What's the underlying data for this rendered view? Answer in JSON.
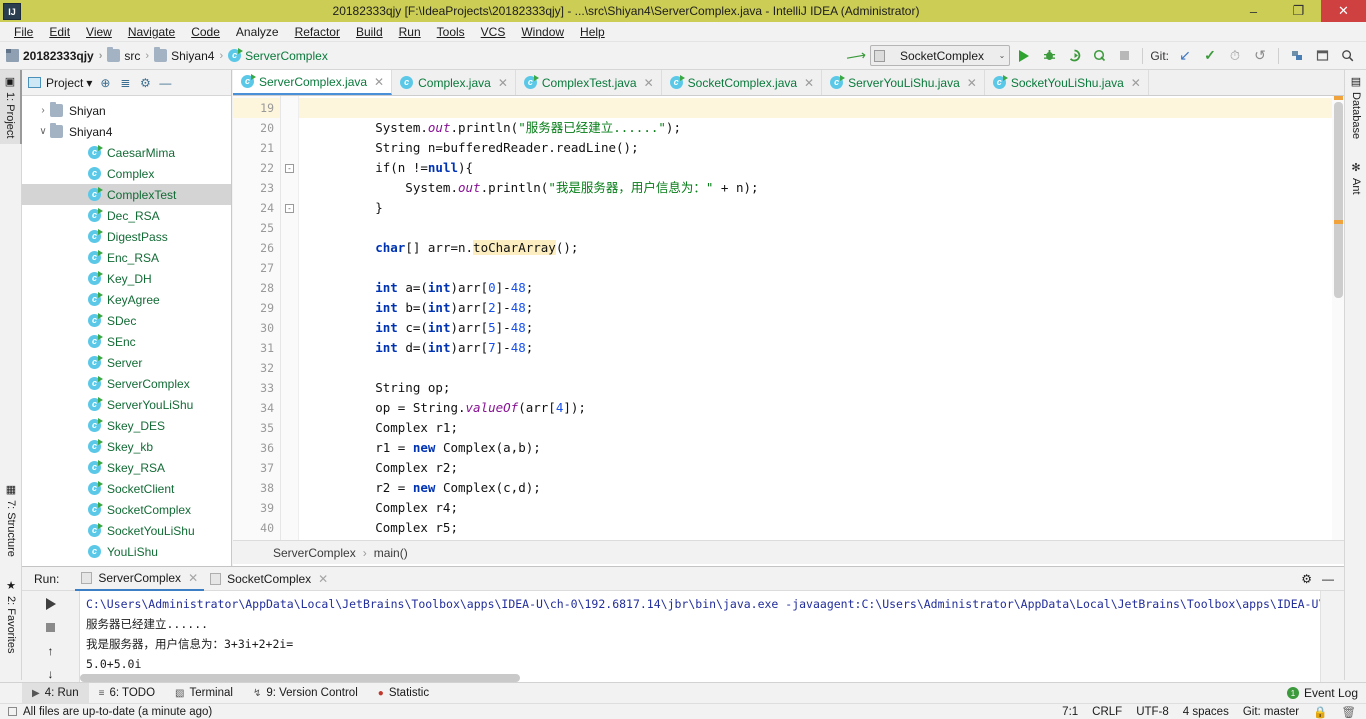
{
  "window": {
    "title": "20182333qjy [F:\\IdeaProjects\\20182333qjy] - ...\\src\\Shiyan4\\ServerComplex.java - IntelliJ IDEA (Administrator)",
    "logo": "IJ",
    "minimize": "–",
    "maximize": "❐",
    "close": "✕",
    "titlebar_color": "#cccd55"
  },
  "menubar": [
    {
      "label": "File"
    },
    {
      "label": "Edit"
    },
    {
      "label": "View"
    },
    {
      "label": "Navigate"
    },
    {
      "label": "Code"
    },
    {
      "label": "Analyze"
    },
    {
      "label": "Refactor"
    },
    {
      "label": "Build"
    },
    {
      "label": "Run"
    },
    {
      "label": "Tools"
    },
    {
      "label": "VCS"
    },
    {
      "label": "Window"
    },
    {
      "label": "Help"
    }
  ],
  "navbar": {
    "breadcrumbs": [
      {
        "label": "20182333qjy",
        "icon": "module-icon"
      },
      {
        "label": "src",
        "icon": "folder-icon"
      },
      {
        "label": "Shiyan4",
        "icon": "folder-icon"
      },
      {
        "label": "ServerComplex",
        "icon": "java-class-icon"
      }
    ],
    "run_config": "SocketComplex",
    "run_config_arrow": "⌄",
    "git_label": "Git:",
    "icons": [
      "back-arrow-icon",
      "run-icon",
      "debug-icon",
      "run-coverage-icon",
      "profile-icon",
      "stop-icon",
      "update-project-icon",
      "commit-icon",
      "history-icon",
      "rollback-icon",
      "settings-sync-icon",
      "layout-icon",
      "search-everywhere-icon"
    ]
  },
  "left_strip": [
    {
      "label": "1: Project",
      "selected": true,
      "icon": "project-icon"
    },
    {
      "label": "7: Structure",
      "selected": false,
      "icon": "structure-icon"
    },
    {
      "label": "2: Favorites",
      "selected": false,
      "icon": "star-icon"
    }
  ],
  "right_strip": [
    {
      "label": "Database",
      "icon": "database-icon"
    },
    {
      "label": "Ant",
      "icon": "ant-icon"
    }
  ],
  "project_panel": {
    "title": "Project",
    "title_arrow": "▾",
    "header_icons": [
      "locate-icon",
      "collapse-all-icon",
      "settings-icon",
      "hide-icon"
    ],
    "tree": [
      {
        "label": "Shiyan",
        "type": "folder",
        "indent": 1,
        "twisty": "›",
        "selected": false
      },
      {
        "label": "Shiyan4",
        "type": "folder",
        "indent": 1,
        "twisty": "∨",
        "selected": false
      },
      {
        "label": "CaesarMima",
        "type": "class-run",
        "indent": 2,
        "twisty": "",
        "selected": false
      },
      {
        "label": "Complex",
        "type": "class",
        "indent": 2,
        "twisty": "",
        "selected": false
      },
      {
        "label": "ComplexTest",
        "type": "class-run",
        "indent": 2,
        "twisty": "",
        "selected": true
      },
      {
        "label": "Dec_RSA",
        "type": "class-run",
        "indent": 2,
        "twisty": "",
        "selected": false
      },
      {
        "label": "DigestPass",
        "type": "class-run",
        "indent": 2,
        "twisty": "",
        "selected": false
      },
      {
        "label": "Enc_RSA",
        "type": "class-run",
        "indent": 2,
        "twisty": "",
        "selected": false
      },
      {
        "label": "Key_DH",
        "type": "class-run",
        "indent": 2,
        "twisty": "",
        "selected": false
      },
      {
        "label": "KeyAgree",
        "type": "class-run",
        "indent": 2,
        "twisty": "",
        "selected": false
      },
      {
        "label": "SDec",
        "type": "class-run",
        "indent": 2,
        "twisty": "",
        "selected": false
      },
      {
        "label": "SEnc",
        "type": "class-run",
        "indent": 2,
        "twisty": "",
        "selected": false
      },
      {
        "label": "Server",
        "type": "class-run",
        "indent": 2,
        "twisty": "",
        "selected": false
      },
      {
        "label": "ServerComplex",
        "type": "class-run",
        "indent": 2,
        "twisty": "",
        "selected": false
      },
      {
        "label": "ServerYouLiShu",
        "type": "class-run",
        "indent": 2,
        "twisty": "",
        "selected": false
      },
      {
        "label": "Skey_DES",
        "type": "class-run",
        "indent": 2,
        "twisty": "",
        "selected": false
      },
      {
        "label": "Skey_kb",
        "type": "class-run",
        "indent": 2,
        "twisty": "",
        "selected": false
      },
      {
        "label": "Skey_RSA",
        "type": "class-run",
        "indent": 2,
        "twisty": "",
        "selected": false
      },
      {
        "label": "SocketClient",
        "type": "class-run",
        "indent": 2,
        "twisty": "",
        "selected": false
      },
      {
        "label": "SocketComplex",
        "type": "class-run",
        "indent": 2,
        "twisty": "",
        "selected": false
      },
      {
        "label": "SocketYouLiShu",
        "type": "class-run",
        "indent": 2,
        "twisty": "",
        "selected": false
      },
      {
        "label": "YouLiShu",
        "type": "class",
        "indent": 2,
        "twisty": "",
        "selected": false
      }
    ]
  },
  "editor": {
    "tabs": [
      {
        "label": "ServerComplex.java",
        "active": true,
        "icon": "java-class-run-icon"
      },
      {
        "label": "Complex.java",
        "active": false,
        "icon": "java-class-icon"
      },
      {
        "label": "ComplexTest.java",
        "active": false,
        "icon": "java-class-run-icon"
      },
      {
        "label": "SocketComplex.java",
        "active": false,
        "icon": "java-class-run-icon"
      },
      {
        "label": "ServerYouLiShu.java",
        "active": false,
        "icon": "java-class-run-icon"
      },
      {
        "label": "SocketYouLiShu.java",
        "active": false,
        "icon": "java-class-run-icon"
      }
    ],
    "close_glyph": "✕",
    "first_line_number": 19,
    "highlight_line": 19,
    "lines": [
      {
        "n": 19,
        "fold": "",
        "segs": []
      },
      {
        "n": 20,
        "fold": "",
        "segs": [
          {
            "t": "        System.",
            "c": "mth"
          },
          {
            "t": "out",
            "c": "fld"
          },
          {
            "t": ".println(",
            "c": "mth"
          },
          {
            "t": "\"服务器已经建立......\"",
            "c": "str"
          },
          {
            "t": ");",
            "c": "mth"
          }
        ]
      },
      {
        "n": 21,
        "fold": "",
        "segs": [
          {
            "t": "        String n=bufferedReader.readLine();",
            "c": "mth"
          }
        ]
      },
      {
        "n": 22,
        "fold": "minus",
        "segs": [
          {
            "t": "        if(n !=",
            "c": "mth"
          },
          {
            "t": "null",
            "c": "kw"
          },
          {
            "t": "){",
            "c": "mth"
          }
        ]
      },
      {
        "n": 23,
        "fold": "",
        "segs": [
          {
            "t": "            System.",
            "c": "mth"
          },
          {
            "t": "out",
            "c": "fld"
          },
          {
            "t": ".println(",
            "c": "mth"
          },
          {
            "t": "\"我是服务器，用户信息为：\"",
            "c": "str"
          },
          {
            "t": " + n);",
            "c": "mth"
          }
        ]
      },
      {
        "n": 24,
        "fold": "minus",
        "segs": [
          {
            "t": "        }",
            "c": "mth"
          }
        ]
      },
      {
        "n": 25,
        "fold": "",
        "segs": []
      },
      {
        "n": 26,
        "fold": "",
        "segs": [
          {
            "t": "        char",
            "c": "kw"
          },
          {
            "t": "[] arr=n.",
            "c": "mth"
          },
          {
            "t": "toCharArray",
            "c": "hilite"
          },
          {
            "t": "();",
            "c": "mth"
          }
        ]
      },
      {
        "n": 27,
        "fold": "",
        "segs": []
      },
      {
        "n": 28,
        "fold": "",
        "segs": [
          {
            "t": "        int",
            "c": "kw"
          },
          {
            "t": " a=(",
            "c": "mth"
          },
          {
            "t": "int",
            "c": "kw"
          },
          {
            "t": ")arr[",
            "c": "mth"
          },
          {
            "t": "0",
            "c": "num"
          },
          {
            "t": "]-",
            "c": "mth"
          },
          {
            "t": "48",
            "c": "num"
          },
          {
            "t": ";",
            "c": "mth"
          }
        ]
      },
      {
        "n": 29,
        "fold": "",
        "segs": [
          {
            "t": "        int",
            "c": "kw"
          },
          {
            "t": " b=(",
            "c": "mth"
          },
          {
            "t": "int",
            "c": "kw"
          },
          {
            "t": ")arr[",
            "c": "mth"
          },
          {
            "t": "2",
            "c": "num"
          },
          {
            "t": "]-",
            "c": "mth"
          },
          {
            "t": "48",
            "c": "num"
          },
          {
            "t": ";",
            "c": "mth"
          }
        ]
      },
      {
        "n": 30,
        "fold": "",
        "segs": [
          {
            "t": "        int",
            "c": "kw"
          },
          {
            "t": " c=(",
            "c": "mth"
          },
          {
            "t": "int",
            "c": "kw"
          },
          {
            "t": ")arr[",
            "c": "mth"
          },
          {
            "t": "5",
            "c": "num"
          },
          {
            "t": "]-",
            "c": "mth"
          },
          {
            "t": "48",
            "c": "num"
          },
          {
            "t": ";",
            "c": "mth"
          }
        ]
      },
      {
        "n": 31,
        "fold": "",
        "segs": [
          {
            "t": "        int",
            "c": "kw"
          },
          {
            "t": " d=(",
            "c": "mth"
          },
          {
            "t": "int",
            "c": "kw"
          },
          {
            "t": ")arr[",
            "c": "mth"
          },
          {
            "t": "7",
            "c": "num"
          },
          {
            "t": "]-",
            "c": "mth"
          },
          {
            "t": "48",
            "c": "num"
          },
          {
            "t": ";",
            "c": "mth"
          }
        ]
      },
      {
        "n": 32,
        "fold": "",
        "segs": []
      },
      {
        "n": 33,
        "fold": "",
        "segs": [
          {
            "t": "        String op;",
            "c": "mth"
          }
        ]
      },
      {
        "n": 34,
        "fold": "",
        "segs": [
          {
            "t": "        op = String.",
            "c": "mth"
          },
          {
            "t": "valueOf",
            "c": "fld"
          },
          {
            "t": "(arr[",
            "c": "mth"
          },
          {
            "t": "4",
            "c": "num"
          },
          {
            "t": "]);",
            "c": "mth"
          }
        ]
      },
      {
        "n": 35,
        "fold": "",
        "segs": [
          {
            "t": "        Complex r1;",
            "c": "mth"
          }
        ]
      },
      {
        "n": 36,
        "fold": "",
        "segs": [
          {
            "t": "        r1 = ",
            "c": "mth"
          },
          {
            "t": "new",
            "c": "kw"
          },
          {
            "t": " Complex(a,b);",
            "c": "mth"
          }
        ]
      },
      {
        "n": 37,
        "fold": "",
        "segs": [
          {
            "t": "        Complex r2;",
            "c": "mth"
          }
        ]
      },
      {
        "n": 38,
        "fold": "",
        "segs": [
          {
            "t": "        r2 = ",
            "c": "mth"
          },
          {
            "t": "new",
            "c": "kw"
          },
          {
            "t": " Complex(c,d);",
            "c": "mth"
          }
        ]
      },
      {
        "n": 39,
        "fold": "",
        "segs": [
          {
            "t": "        Complex r4;",
            "c": "mth"
          }
        ]
      },
      {
        "n": 40,
        "fold": "",
        "segs": [
          {
            "t": "        Complex r5;",
            "c": "mth"
          }
        ]
      }
    ],
    "breadcrumb": [
      "ServerComplex",
      "main()"
    ],
    "breadcrumb_sep": "›"
  },
  "run_panel": {
    "label": "Run:",
    "tabs": [
      {
        "label": "ServerComplex",
        "active": true
      },
      {
        "label": "SocketComplex",
        "active": false
      }
    ],
    "close_glyph": "✕",
    "header_icons": [
      "settings-icon",
      "hide-icon"
    ],
    "gutter_icons": [
      "rerun-icon",
      "stop-icon",
      "up-icon",
      "down-icon"
    ],
    "console": [
      {
        "text": "C:\\Users\\Administrator\\AppData\\Local\\JetBrains\\Toolbox\\apps\\IDEA-U\\ch-0\\192.6817.14\\jbr\\bin\\java.exe -javaagent:C:\\Users\\Administrator\\AppData\\Local\\JetBrains\\Toolbox\\apps\\IDEA-U\\",
        "blue": true
      },
      {
        "text": "服务器已经建立......",
        "blue": false
      },
      {
        "text": "我是服务器，用户信息为：3+3i+2+2i=",
        "blue": false
      },
      {
        "text": "5.0+5.0i",
        "blue": false
      }
    ]
  },
  "bottom_tabs": [
    {
      "label": "4: Run",
      "icon": "run-icon",
      "selected": true
    },
    {
      "label": "6: TODO",
      "icon": "todo-icon",
      "selected": false
    },
    {
      "label": "Terminal",
      "icon": "terminal-icon",
      "selected": false
    },
    {
      "label": "9: Version Control",
      "icon": "vcs-icon",
      "selected": false
    },
    {
      "label": "Statistic",
      "icon": "statistic-icon",
      "selected": false
    }
  ],
  "event_log": {
    "label": "Event Log",
    "badge": "1"
  },
  "statusbar": {
    "message": "All files are up-to-date (a minute ago)",
    "caret": "7:1",
    "line_separator": "CRLF",
    "encoding": "UTF-8",
    "indent": "4 spaces",
    "git_branch": "Git: master",
    "lock_icon": "lock-icon",
    "trash_icon": "trash-icon"
  }
}
